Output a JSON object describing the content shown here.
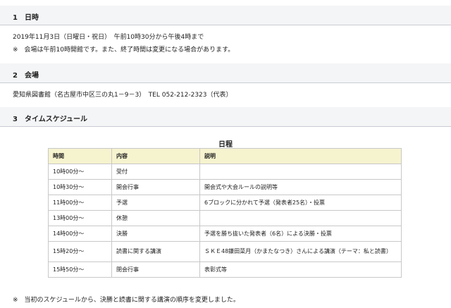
{
  "sections": [
    {
      "heading": "1　日時",
      "lines": [
        "2019年11月3日（日曜日・祝日）　午前10時30分から午後4時まで",
        "※　会場は午前10時開館です。また、終了時間は変更になる場合があります。"
      ]
    },
    {
      "heading": "2　会場",
      "lines": [
        "愛知県図書館（名古屋市中区三の丸1－9－3）　TEL 052-212-2323（代表）"
      ]
    },
    {
      "heading": "3　タイムスケジュール",
      "lines": []
    }
  ],
  "schedule": {
    "caption": "日程",
    "headers": [
      "時間",
      "内容",
      "説明"
    ],
    "rows": [
      [
        "10時00分～",
        "受付",
        ""
      ],
      [
        "10時30分～",
        "開会行事",
        "開会式や大会ルールの説明等"
      ],
      [
        "11時00分～",
        "予選",
        "6ブロックに分かれて予選（発表者25名）・投票"
      ],
      [
        "13時00分～",
        "休憩",
        ""
      ],
      [
        "14時00分～",
        "決勝",
        "予選を勝ち抜いた発表者（6名）による決勝・投票"
      ],
      [
        "15時20分～",
        "読書に関する講演",
        "ＳＫＥ48鎌田菜月（かまたなつき）さんによる講演（テーマ：私と読書）"
      ],
      [
        "15時50分～",
        "閉会行事",
        "表彰式等"
      ]
    ]
  },
  "note": "※　当初のスケジュールから、決勝と読書に関する講演の順序を変更しました。"
}
